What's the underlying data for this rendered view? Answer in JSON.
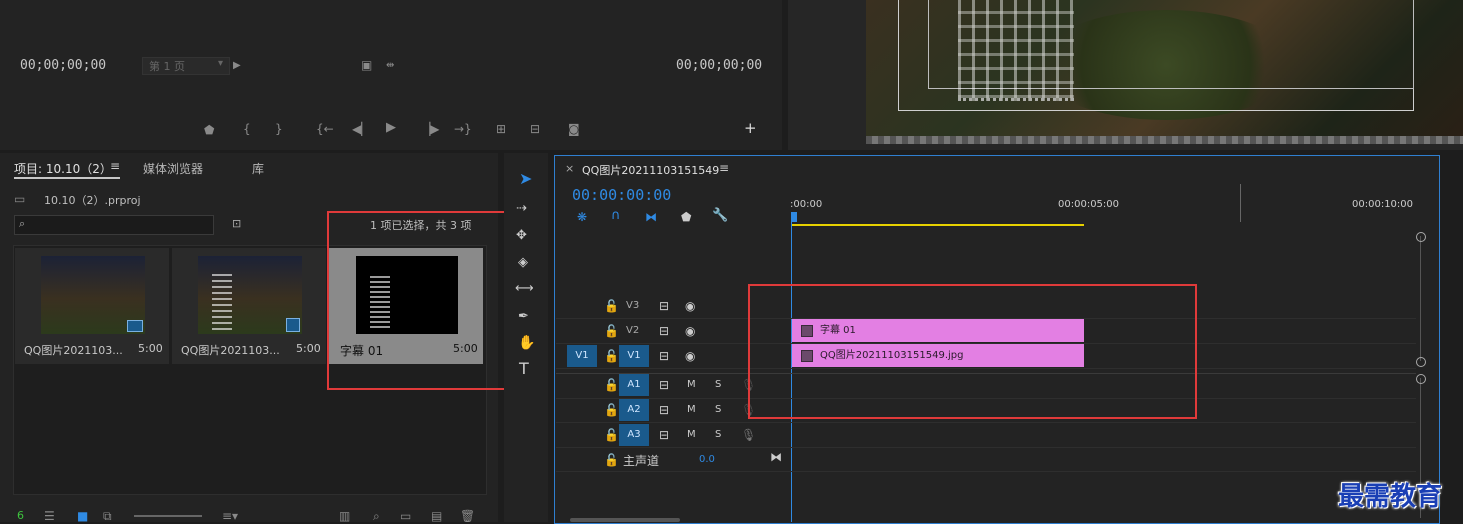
{
  "source_monitor": {
    "timecode_left": "00;00;00;00",
    "page_select": "第 1 页",
    "timecode_right": "00;00;00;00"
  },
  "project_panel": {
    "tabs": [
      {
        "label": "项目: 10.10（2）"
      },
      {
        "label": "媒体浏览器"
      },
      {
        "label": "库"
      }
    ],
    "file_name": "10.10（2）.prproj",
    "search_placeholder": "",
    "selection_status": "1 项已选择，共 3 项",
    "items": [
      {
        "name": "QQ图片2021103...",
        "duration": "5:00"
      },
      {
        "name": "QQ图片2021103...",
        "duration": "5:00"
      },
      {
        "name": "字幕 01",
        "duration": "5:00"
      }
    ],
    "footer_count": "6"
  },
  "timeline": {
    "sequence_name": "QQ图片20211103151549",
    "timecode": "00:00:00:00",
    "ruler": [
      ":00:00",
      "00:00:05:00",
      "00:00:10:00"
    ],
    "video_tracks": [
      {
        "label": "V3"
      },
      {
        "label": "V2"
      },
      {
        "label": "V1",
        "source": "V1"
      }
    ],
    "audio_tracks": [
      {
        "label": "A1",
        "m": "M",
        "s": "S"
      },
      {
        "label": "A2",
        "m": "M",
        "s": "S"
      },
      {
        "label": "A3",
        "m": "M",
        "s": "S"
      }
    ],
    "master": {
      "label": "主声道",
      "value": "0.0"
    },
    "clips": [
      {
        "name": "字幕 01"
      },
      {
        "name": "QQ图片20211103151549.jpg"
      }
    ]
  },
  "watermark": "最需教育",
  "colors": {
    "accent": "#2f8ae3",
    "clip": "#e37fe3",
    "highlight_box": "#e03a3a",
    "playhead": "#2f8ae3"
  }
}
